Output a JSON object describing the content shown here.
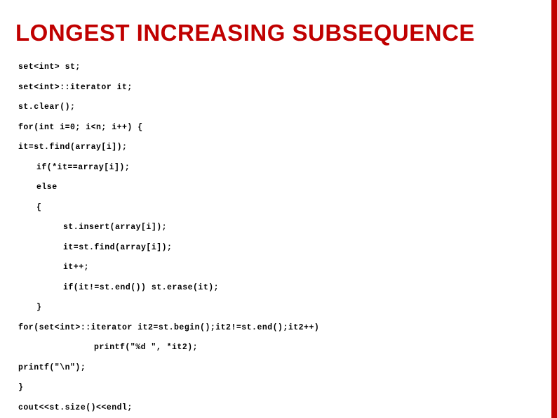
{
  "title": "LONGEST INCREASING SUBSEQUENCE",
  "code": {
    "l1": "set<int> st;",
    "l2": "set<int>::iterator it;",
    "l3": "st.clear();",
    "l4": "for(int i=0; i<n; i++) {",
    "l5": "it=st.find(array[i]);",
    "l6": "if(*it==array[i]);",
    "l7": "else",
    "l8": "{",
    "l9": "st.insert(array[i]);",
    "l10": "it=st.find(array[i]);",
    "l11": "it++;",
    "l12": "if(it!=st.end()) st.erase(it);",
    "l13": "}",
    "l14": "for(set<int>::iterator it2=st.begin();it2!=st.end();it2++)",
    "l15": "printf(\"%d \", *it2);",
    "l16": "printf(\"\\n\");",
    "l17": "}",
    "l18": "cout<<st.size()<<endl;"
  }
}
